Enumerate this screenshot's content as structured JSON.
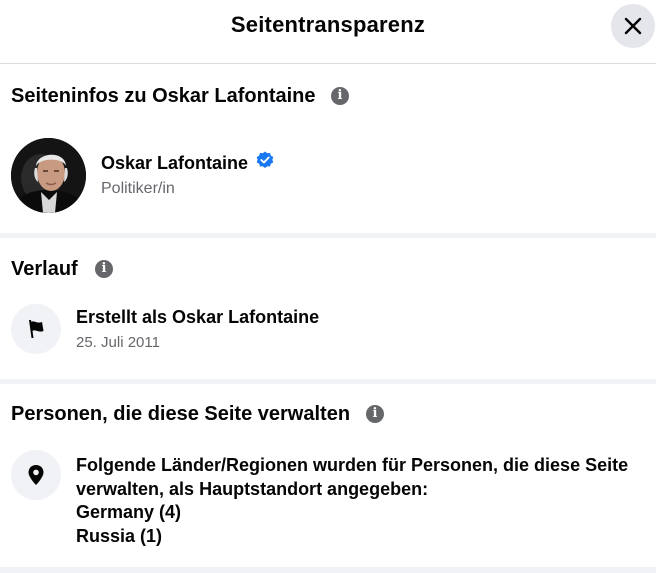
{
  "header": {
    "title": "Seitentransparenz"
  },
  "page_info": {
    "section_title": "Seiteninfos zu Oskar Lafontaine",
    "name": "Oskar Lafontaine",
    "category": "Politiker/in"
  },
  "history": {
    "section_title": "Verlauf",
    "event": "Erstellt als Oskar Lafontaine",
    "date": "25. Juli 2011"
  },
  "managers": {
    "section_title": "Personen, die diese Seite verwalten",
    "description": "Folgende Länder/Regionen wurden für Personen, die diese Seite verwalten, als Hauptstandort angegeben:",
    "countries": [
      "Germany (4)",
      "Russia (1)"
    ]
  },
  "colors": {
    "verified_badge": "#1877f2",
    "secondary_text": "#65676b",
    "divider": "#f0f2f5"
  },
  "icons": [
    "close-icon",
    "info-icon",
    "verified-badge-icon",
    "flag-icon",
    "location-pin-icon"
  ]
}
